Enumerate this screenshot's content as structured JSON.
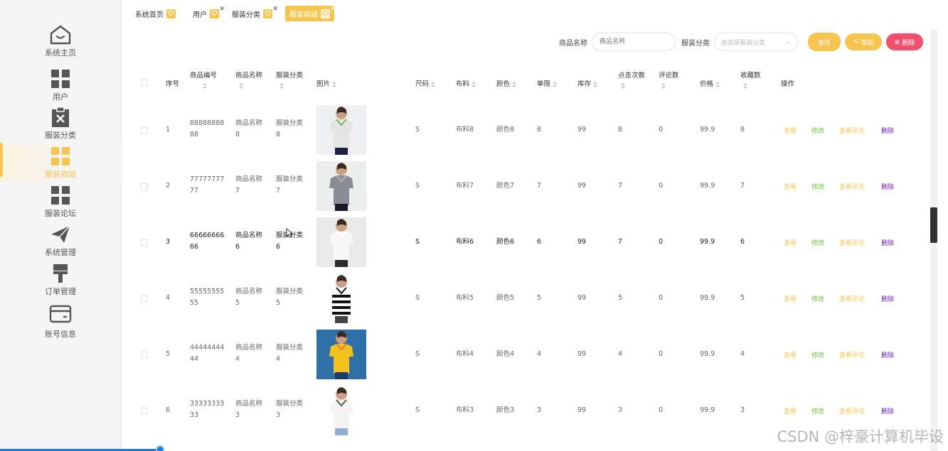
{
  "sidebar": {
    "items": [
      {
        "label": "系统主页",
        "icon": "home-icon"
      },
      {
        "label": "用户",
        "icon": "grid-icon"
      },
      {
        "label": "服装分类",
        "icon": "clipboard-x-icon"
      },
      {
        "label": "服装商城",
        "icon": "grid-icon",
        "active": true
      },
      {
        "label": "服装论坛",
        "icon": "grid-icon"
      },
      {
        "label": "系统管理",
        "icon": "paper-plane-icon"
      },
      {
        "label": "订单管理",
        "icon": "brush-icon"
      },
      {
        "label": "账号信息",
        "icon": "card-icon"
      }
    ]
  },
  "tags": [
    {
      "label": "系统首页",
      "closable": false
    },
    {
      "label": "用户",
      "closable": true
    },
    {
      "label": "服装分类",
      "closable": true
    },
    {
      "label": "服装商城",
      "closable": true,
      "active": true
    }
  ],
  "search": {
    "name_label": "商品名称",
    "name_placeholder": "商品名称",
    "category_label": "服装分类",
    "category_placeholder": "请选择服装分类",
    "search_btn": "查找",
    "add_btn": "添加",
    "delete_btn": "删除"
  },
  "columns": {
    "index": "序号",
    "code": "商品编号",
    "name": "商品名称",
    "category": "服装分类",
    "image": "图片",
    "size": "尺码",
    "fabric": "布料",
    "color": "颜色",
    "limit": "单限",
    "stock": "库存",
    "clicks": "点击次数",
    "comments": "评论数",
    "price": "价格",
    "favorites": "收藏数",
    "actions": "操作"
  },
  "actions": {
    "view": "查看",
    "edit": "修改",
    "comments": "查看评论",
    "delete": "删除"
  },
  "rows": [
    {
      "index": "1",
      "code1": "88888888",
      "code2": "88",
      "name1": "商品名称",
      "name2": "8",
      "cat1": "服装分类",
      "cat2": "8",
      "size": "S",
      "fabric": "布料8",
      "color": "颜色8",
      "limit": "8",
      "stock": "99",
      "clicks": "8",
      "comments": "0",
      "price": "99.9",
      "favorites": "8"
    },
    {
      "index": "2",
      "code1": "77777777",
      "code2": "77",
      "name1": "商品名称",
      "name2": "7",
      "cat1": "服装分类",
      "cat2": "7",
      "size": "S",
      "fabric": "布料7",
      "color": "颜色7",
      "limit": "7",
      "stock": "99",
      "clicks": "7",
      "comments": "0",
      "price": "99.9",
      "favorites": "7"
    },
    {
      "index": "3",
      "code1": "66666666",
      "code2": "66",
      "name1": "商品名称",
      "name2": "6",
      "cat1": "服装分类",
      "cat2": "6",
      "size": "S",
      "fabric": "布料6",
      "color": "颜色6",
      "limit": "6",
      "stock": "99",
      "clicks": "7",
      "comments": "0",
      "price": "99.9",
      "favorites": "6"
    },
    {
      "index": "4",
      "code1": "55555555",
      "code2": "55",
      "name1": "商品名称",
      "name2": "5",
      "cat1": "服装分类",
      "cat2": "5",
      "size": "S",
      "fabric": "布料5",
      "color": "颜色5",
      "limit": "5",
      "stock": "99",
      "clicks": "5",
      "comments": "0",
      "price": "99.9",
      "favorites": "5"
    },
    {
      "index": "5",
      "code1": "44444444",
      "code2": "44",
      "name1": "商品名称",
      "name2": "4",
      "cat1": "服装分类",
      "cat2": "4",
      "size": "S",
      "fabric": "布料4",
      "color": "颜色4",
      "limit": "4",
      "stock": "99",
      "clicks": "4",
      "comments": "0",
      "price": "99.9",
      "favorites": "4"
    },
    {
      "index": "6",
      "code1": "33333333",
      "code2": "33",
      "name1": "商品名称",
      "name2": "3",
      "cat1": "服装分类",
      "cat2": "3",
      "size": "S",
      "fabric": "布料3",
      "color": "颜色3",
      "limit": "3",
      "stock": "99",
      "clicks": "3",
      "comments": "0",
      "price": "99.9",
      "favorites": "3"
    }
  ],
  "watermark": "CSDN @梓豪计算机毕设",
  "colors": {
    "accent": "#f5c451",
    "danger": "#f0506e",
    "edit": "#67c23a",
    "delete_link": "#6a1fb3"
  }
}
